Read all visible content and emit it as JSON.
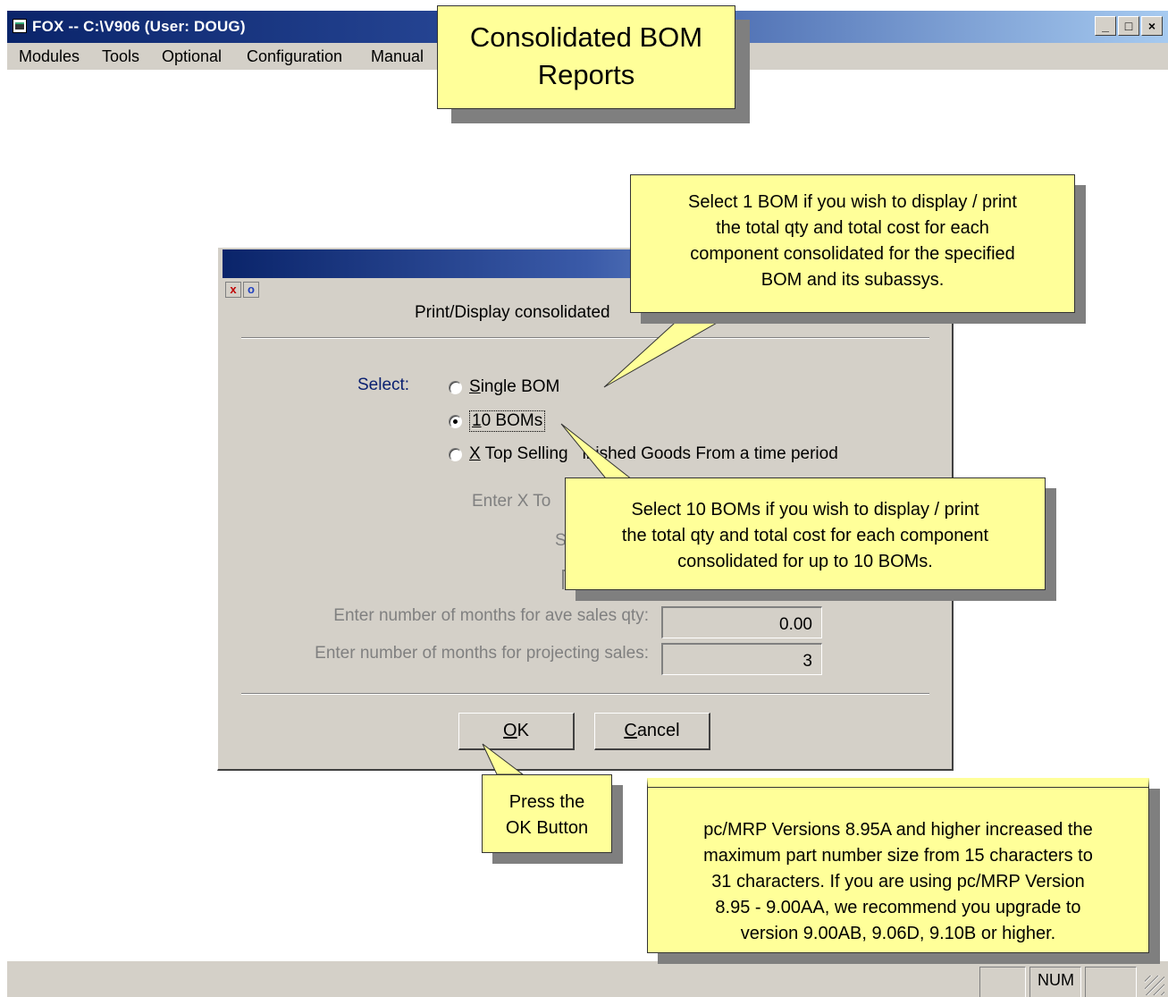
{
  "app": {
    "title": "FOX -- C:\\V906  (User: DOUG)",
    "window_buttons": [
      "_",
      "□",
      "×"
    ]
  },
  "menu": {
    "items": [
      "Modules",
      "Tools",
      "Optional",
      "Configuration",
      "Manual"
    ]
  },
  "title_note": [
    "Consolidated BOM",
    "Reports"
  ],
  "dialog": {
    "heading": "Print/Display consolidated",
    "close_icon": "x",
    "help_icon": "o",
    "select_label": "Select:",
    "options": [
      {
        "prefix": "",
        "accel": "S",
        "rest": "ingle BOM",
        "checked": false
      },
      {
        "prefix": "",
        "accel": "1",
        "rest": "0 BOMs",
        "checked": true
      },
      {
        "prefix": "",
        "accel": "X",
        "rest": " Top Selling Finished Goods From a time period",
        "checked": false
      }
    ],
    "option3_visible": " Top Selling",
    "option3_tail": "inished Goods From a time period",
    "enter_x_label": "Enter X To",
    "partial_s": "S",
    "months_ave_label": "Enter number of months for ave sales qty:",
    "months_ave_value": "0.00",
    "months_proj_label": "Enter number of months for projecting sales:",
    "months_proj_value": "3",
    "ok_accel": "O",
    "ok_rest": "K",
    "cancel_accel": "C",
    "cancel_rest": "ancel"
  },
  "notes": {
    "single_bom": [
      "Select 1 BOM if you wish to display / print",
      "the total qty and total cost for each",
      "component consolidated for the specified",
      "BOM and its subassys."
    ],
    "ten_boms": [
      "Select 10 BOMs if you wish to display / print",
      "the total qty and total cost for each component",
      "consolidated for up to 10 BOMs."
    ],
    "ok_button": [
      "Press the",
      "OK Button"
    ],
    "version": [
      "pc/MRP Versions 8.95A and higher increased the",
      "maximum part number size from 15 characters to",
      "31 characters.  If you are using pc/MRP Version",
      "8.95 - 9.00AA, we recommend you upgrade to",
      "version 9.00AB, 9.06D, 9.10B or higher."
    ]
  },
  "status": {
    "num": "NUM"
  },
  "colors": {
    "titlebar_start": "#0a246a",
    "titlebar_end": "#a6caf0",
    "note_fill": "#ffff99",
    "dialog_bg": "#d4d0c8"
  }
}
